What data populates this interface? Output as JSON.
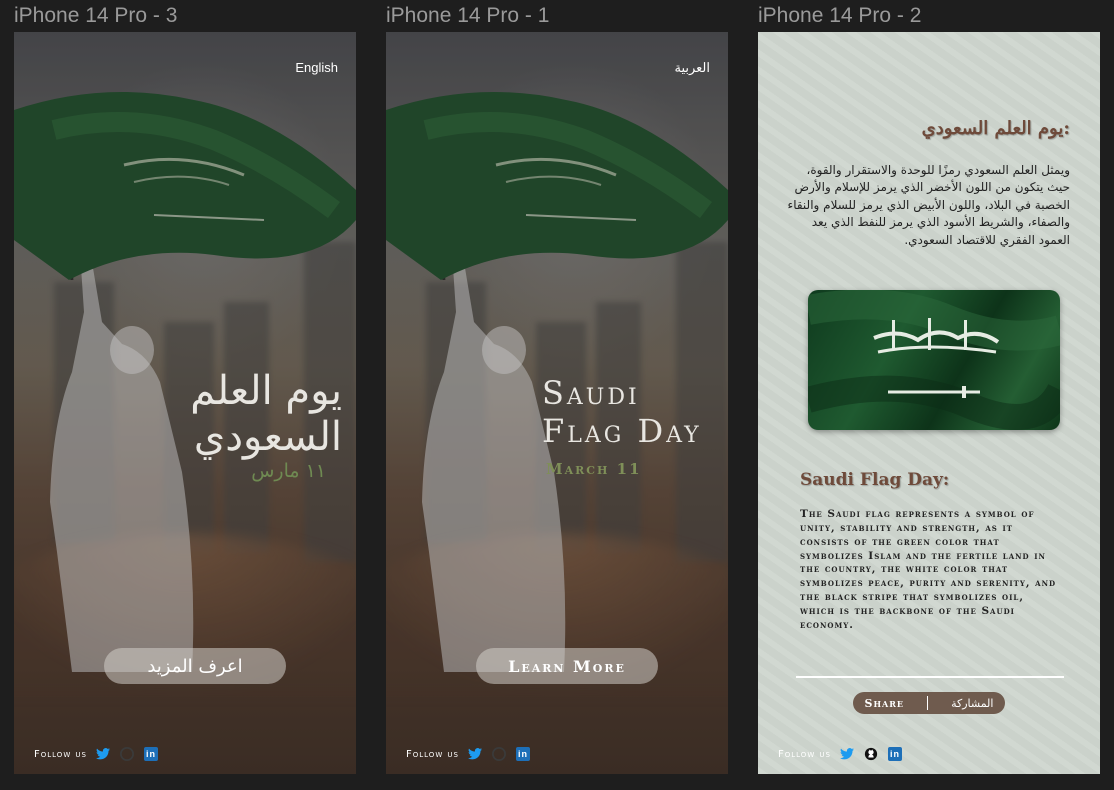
{
  "frames": [
    {
      "label": "iPhone 14 Pro - 3"
    },
    {
      "label": "iPhone 14 Pro - 1"
    },
    {
      "label": "iPhone 14 Pro - 2"
    }
  ],
  "ar_screen": {
    "lang_switch": "English",
    "title": "يوم العلم السعودي",
    "date": "١١ مارس",
    "cta": "اعرف المزيد",
    "follow": "Follow us"
  },
  "en_screen": {
    "lang_switch": "العربية",
    "title_line1": "Saudi",
    "title_line2": "Flag Day",
    "date": "March 11",
    "cta": "Learn More",
    "follow": "Follow us"
  },
  "details_screen": {
    "heading_ar": "يوم العلم السعودي:",
    "body_ar": "ويمثل العلم السعودي رمزًا للوحدة والاستقرار والقوة، حيث يتكون من اللون الأخضر الذي يرمز للإسلام والأرض الخصبة في البلاد، واللون الأبيض الذي يرمز للسلام والنقاء والصفاء، والشريط الأسود الذي يرمز للنفط الذي يعد العمود الفقري للاقتصاد السعودي.",
    "heading_en": "Saudi Flag Day:",
    "body_en": "The Saudi flag represents a symbol of unity, stability and strength, as it consists of the green color that symbolizes Islam and the fertile land in the country, the white color that symbolizes peace, purity and serenity, and the black stripe that symbolizes oil, which is the backbone of the Saudi economy.",
    "share_en": "Share",
    "share_ar": "المشاركة",
    "follow": "Follow us"
  },
  "social_icons": [
    "twitter-icon",
    "github-icon",
    "linkedin-icon"
  ],
  "colors": {
    "flag_green": "#1f5a30",
    "accent_brown": "#6e4a3a",
    "twitter_blue": "#1d9bf0",
    "linkedin_blue": "#1d6fb8"
  }
}
